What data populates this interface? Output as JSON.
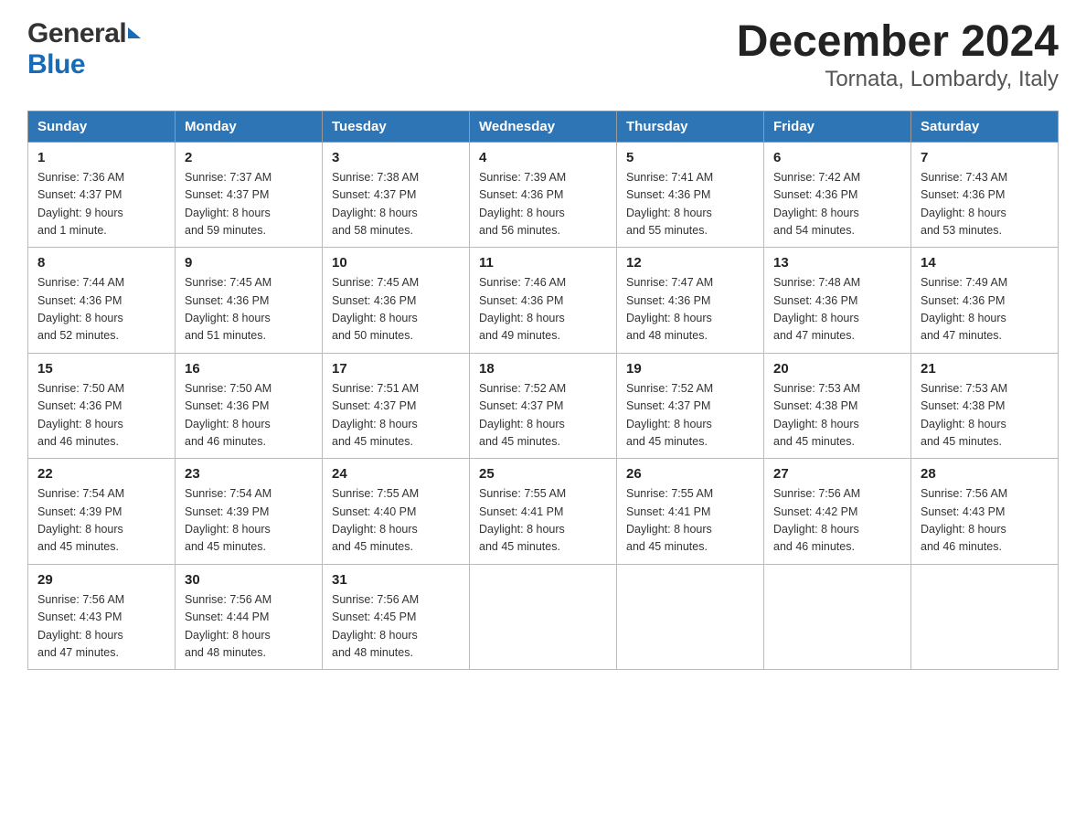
{
  "header": {
    "logo_general": "General",
    "logo_blue": "Blue",
    "title": "December 2024",
    "subtitle": "Tornata, Lombardy, Italy"
  },
  "calendar": {
    "days_of_week": [
      "Sunday",
      "Monday",
      "Tuesday",
      "Wednesday",
      "Thursday",
      "Friday",
      "Saturday"
    ],
    "weeks": [
      [
        {
          "day": "1",
          "sunrise": "7:36 AM",
          "sunset": "4:37 PM",
          "daylight": "9 hours and 1 minute."
        },
        {
          "day": "2",
          "sunrise": "7:37 AM",
          "sunset": "4:37 PM",
          "daylight": "8 hours and 59 minutes."
        },
        {
          "day": "3",
          "sunrise": "7:38 AM",
          "sunset": "4:37 PM",
          "daylight": "8 hours and 58 minutes."
        },
        {
          "day": "4",
          "sunrise": "7:39 AM",
          "sunset": "4:36 PM",
          "daylight": "8 hours and 56 minutes."
        },
        {
          "day": "5",
          "sunrise": "7:41 AM",
          "sunset": "4:36 PM",
          "daylight": "8 hours and 55 minutes."
        },
        {
          "day": "6",
          "sunrise": "7:42 AM",
          "sunset": "4:36 PM",
          "daylight": "8 hours and 54 minutes."
        },
        {
          "day": "7",
          "sunrise": "7:43 AM",
          "sunset": "4:36 PM",
          "daylight": "8 hours and 53 minutes."
        }
      ],
      [
        {
          "day": "8",
          "sunrise": "7:44 AM",
          "sunset": "4:36 PM",
          "daylight": "8 hours and 52 minutes."
        },
        {
          "day": "9",
          "sunrise": "7:45 AM",
          "sunset": "4:36 PM",
          "daylight": "8 hours and 51 minutes."
        },
        {
          "day": "10",
          "sunrise": "7:45 AM",
          "sunset": "4:36 PM",
          "daylight": "8 hours and 50 minutes."
        },
        {
          "day": "11",
          "sunrise": "7:46 AM",
          "sunset": "4:36 PM",
          "daylight": "8 hours and 49 minutes."
        },
        {
          "day": "12",
          "sunrise": "7:47 AM",
          "sunset": "4:36 PM",
          "daylight": "8 hours and 48 minutes."
        },
        {
          "day": "13",
          "sunrise": "7:48 AM",
          "sunset": "4:36 PM",
          "daylight": "8 hours and 47 minutes."
        },
        {
          "day": "14",
          "sunrise": "7:49 AM",
          "sunset": "4:36 PM",
          "daylight": "8 hours and 47 minutes."
        }
      ],
      [
        {
          "day": "15",
          "sunrise": "7:50 AM",
          "sunset": "4:36 PM",
          "daylight": "8 hours and 46 minutes."
        },
        {
          "day": "16",
          "sunrise": "7:50 AM",
          "sunset": "4:36 PM",
          "daylight": "8 hours and 46 minutes."
        },
        {
          "day": "17",
          "sunrise": "7:51 AM",
          "sunset": "4:37 PM",
          "daylight": "8 hours and 45 minutes."
        },
        {
          "day": "18",
          "sunrise": "7:52 AM",
          "sunset": "4:37 PM",
          "daylight": "8 hours and 45 minutes."
        },
        {
          "day": "19",
          "sunrise": "7:52 AM",
          "sunset": "4:37 PM",
          "daylight": "8 hours and 45 minutes."
        },
        {
          "day": "20",
          "sunrise": "7:53 AM",
          "sunset": "4:38 PM",
          "daylight": "8 hours and 45 minutes."
        },
        {
          "day": "21",
          "sunrise": "7:53 AM",
          "sunset": "4:38 PM",
          "daylight": "8 hours and 45 minutes."
        }
      ],
      [
        {
          "day": "22",
          "sunrise": "7:54 AM",
          "sunset": "4:39 PM",
          "daylight": "8 hours and 45 minutes."
        },
        {
          "day": "23",
          "sunrise": "7:54 AM",
          "sunset": "4:39 PM",
          "daylight": "8 hours and 45 minutes."
        },
        {
          "day": "24",
          "sunrise": "7:55 AM",
          "sunset": "4:40 PM",
          "daylight": "8 hours and 45 minutes."
        },
        {
          "day": "25",
          "sunrise": "7:55 AM",
          "sunset": "4:41 PM",
          "daylight": "8 hours and 45 minutes."
        },
        {
          "day": "26",
          "sunrise": "7:55 AM",
          "sunset": "4:41 PM",
          "daylight": "8 hours and 45 minutes."
        },
        {
          "day": "27",
          "sunrise": "7:56 AM",
          "sunset": "4:42 PM",
          "daylight": "8 hours and 46 minutes."
        },
        {
          "day": "28",
          "sunrise": "7:56 AM",
          "sunset": "4:43 PM",
          "daylight": "8 hours and 46 minutes."
        }
      ],
      [
        {
          "day": "29",
          "sunrise": "7:56 AM",
          "sunset": "4:43 PM",
          "daylight": "8 hours and 47 minutes."
        },
        {
          "day": "30",
          "sunrise": "7:56 AM",
          "sunset": "4:44 PM",
          "daylight": "8 hours and 48 minutes."
        },
        {
          "day": "31",
          "sunrise": "7:56 AM",
          "sunset": "4:45 PM",
          "daylight": "8 hours and 48 minutes."
        },
        null,
        null,
        null,
        null
      ]
    ]
  }
}
